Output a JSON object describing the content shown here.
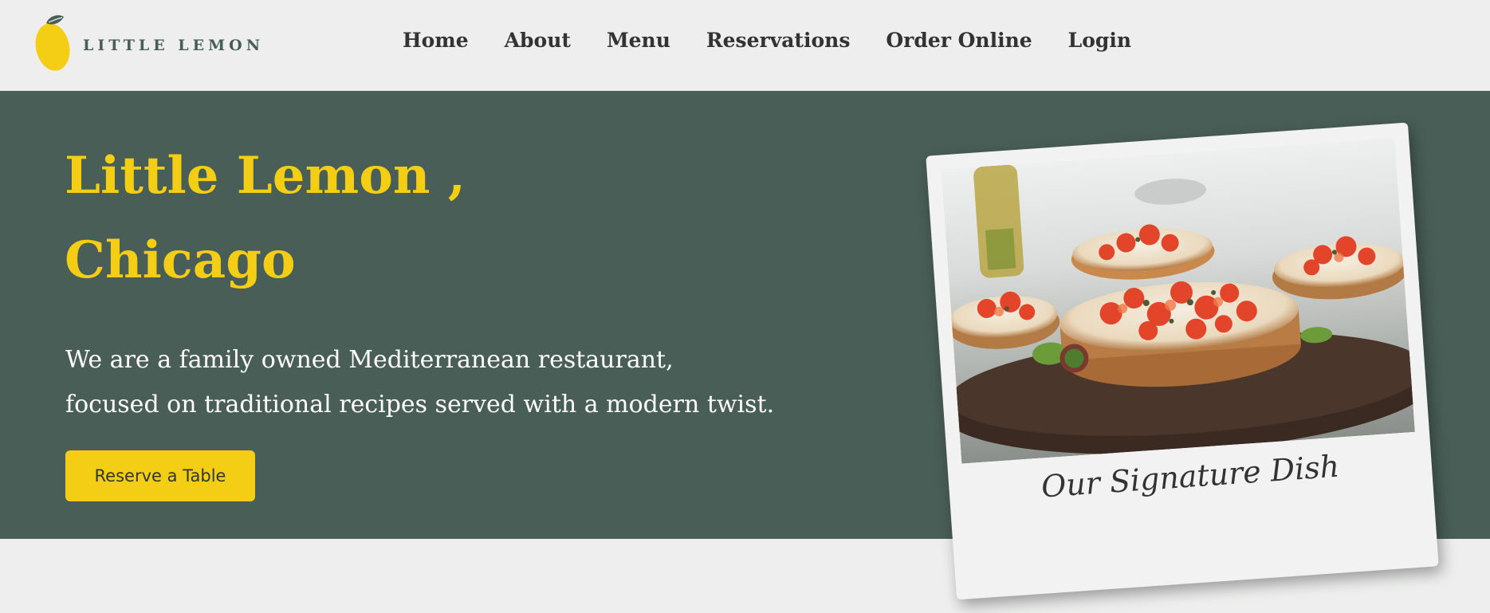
{
  "header": {
    "logo_text": "LITTLE LEMON",
    "logo_icon": "lemon-icon",
    "nav": [
      {
        "label": "Home"
      },
      {
        "label": "About"
      },
      {
        "label": "Menu"
      },
      {
        "label": "Reservations"
      },
      {
        "label": "Order Online"
      },
      {
        "label": "Login"
      }
    ]
  },
  "hero": {
    "title_line1": "Little Lemon ,",
    "title_line2": "Chicago",
    "description_line1": "We are a family owned Mediterranean restaurant,",
    "description_line2": "focused on traditional recipes served with a modern twist.",
    "button_label": "Reserve a Table",
    "image_alt": "bruschetta with tomatoes on a wooden board",
    "caption": "Our Signature Dish"
  },
  "colors": {
    "primary_green": "#495e57",
    "primary_yellow": "#f4ce14",
    "background": "#edeeed",
    "text_dark": "#333333"
  }
}
